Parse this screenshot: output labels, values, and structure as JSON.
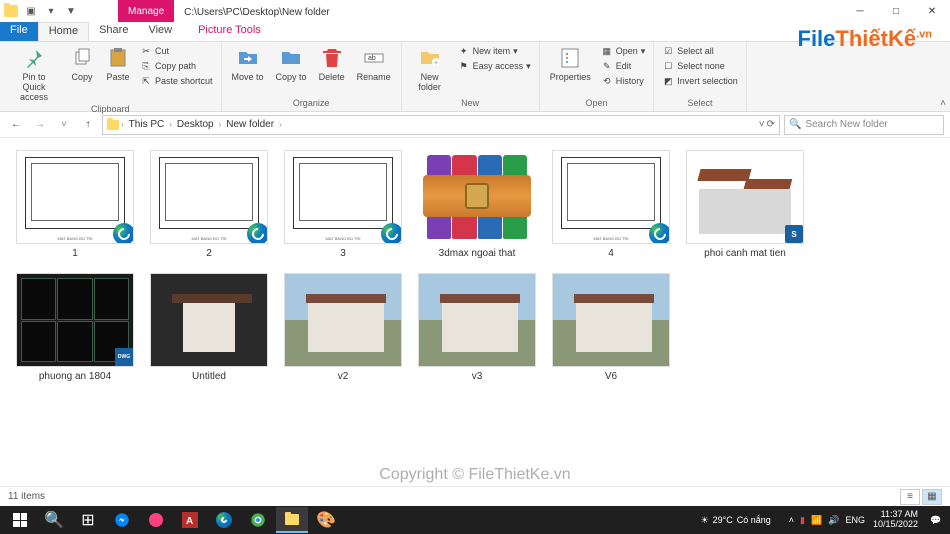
{
  "window": {
    "path": "C:\\Users\\PC\\Desktop\\New folder",
    "context_tab": "Manage",
    "context_group": "Picture Tools"
  },
  "tabs": {
    "file": "File",
    "home": "Home",
    "share": "Share",
    "view": "View"
  },
  "ribbon": {
    "pin": "Pin to Quick access",
    "copy": "Copy",
    "paste": "Paste",
    "cut": "Cut",
    "copy_path": "Copy path",
    "paste_shortcut": "Paste shortcut",
    "clipboard": "Clipboard",
    "move_to": "Move to",
    "copy_to": "Copy to",
    "delete": "Delete",
    "rename": "Rename",
    "organize": "Organize",
    "new_folder": "New folder",
    "new_item": "New item",
    "easy_access": "Easy access",
    "new": "New",
    "properties": "Properties",
    "open": "Open",
    "edit": "Edit",
    "history": "History",
    "open_group": "Open",
    "select_all": "Select all",
    "select_none": "Select none",
    "invert": "Invert selection",
    "select": "Select"
  },
  "breadcrumbs": [
    "This PC",
    "Desktop",
    "New folder"
  ],
  "search": {
    "placeholder": "Search New folder"
  },
  "files": [
    {
      "name": "1",
      "type": "html-floorplan"
    },
    {
      "name": "2",
      "type": "html-floorplan"
    },
    {
      "name": "3",
      "type": "html-floorplan"
    },
    {
      "name": "3dmax ngoai that",
      "type": "rar"
    },
    {
      "name": "4",
      "type": "html-floorplan"
    },
    {
      "name": "phoi canh mat tien",
      "type": "skp"
    },
    {
      "name": "phuong an 1804",
      "type": "dwg"
    },
    {
      "name": "Untitled",
      "type": "render-dark"
    },
    {
      "name": "v2",
      "type": "render"
    },
    {
      "name": "v3",
      "type": "render"
    },
    {
      "name": "V6",
      "type": "render"
    }
  ],
  "status": {
    "count": "11 items"
  },
  "copyright": "Copyright © FileThietKe.vn",
  "logo": {
    "p1": "File",
    "p2": "ThiếtKế",
    "p3": ".vn"
  },
  "taskbar": {
    "weather_temp": "29°C",
    "weather_text": "Có nắng",
    "lang": "ENG",
    "time": "11:37 AM",
    "date": "10/15/2022"
  }
}
